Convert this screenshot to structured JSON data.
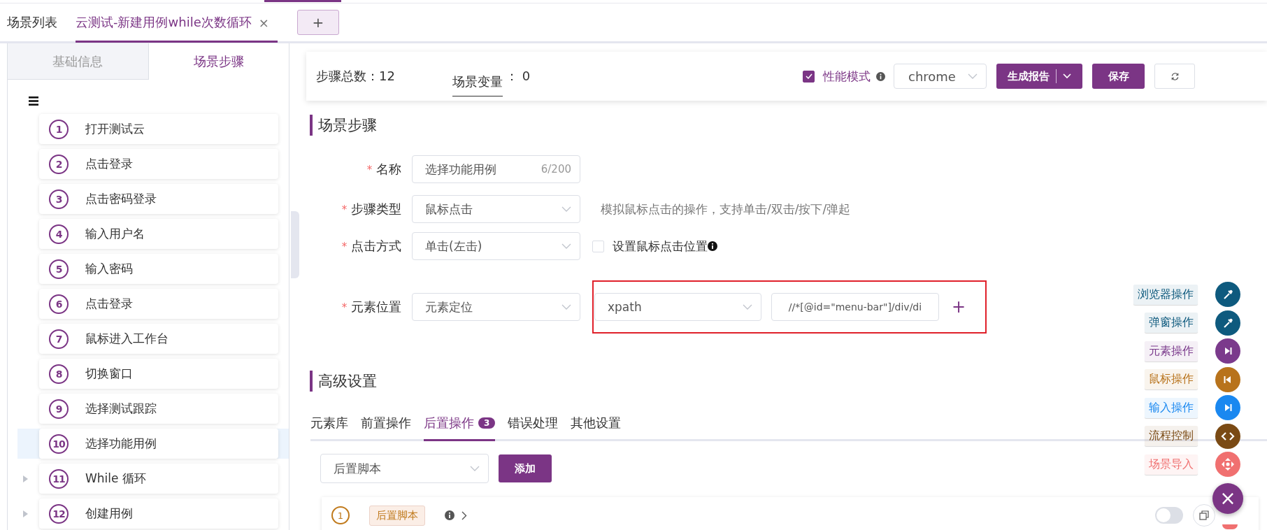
{
  "top_tabs": [
    {
      "label": "场景列表",
      "selected": false
    },
    {
      "label": "云测试-新建用例while次数循环",
      "selected": true,
      "close": "×"
    }
  ],
  "add_tab": "+",
  "side_tabs": [
    {
      "label": "基础信息",
      "selected": false
    },
    {
      "label": "场景步骤",
      "selected": true
    }
  ],
  "steps": [
    {
      "number": "1",
      "label": "打开测试云",
      "selected": false,
      "expandable": false
    },
    {
      "number": "2",
      "label": "点击登录",
      "selected": false,
      "expandable": false
    },
    {
      "number": "3",
      "label": "点击密码登录",
      "selected": false,
      "expandable": false
    },
    {
      "number": "4",
      "label": "输入用户名",
      "selected": false,
      "expandable": false
    },
    {
      "number": "5",
      "label": "输入密码",
      "selected": false,
      "expandable": false
    },
    {
      "number": "6",
      "label": "点击登录",
      "selected": false,
      "expandable": false
    },
    {
      "number": "7",
      "label": "鼠标进入工作台",
      "selected": false,
      "expandable": false
    },
    {
      "number": "8",
      "label": "切换窗口",
      "selected": false,
      "expandable": false
    },
    {
      "number": "9",
      "label": "选择测试跟踪",
      "selected": false,
      "expandable": false
    },
    {
      "number": "10",
      "label": "选择功能用例",
      "selected": true,
      "expandable": false
    },
    {
      "number": "11",
      "label": "While 循环",
      "selected": false,
      "expandable": true
    },
    {
      "number": "12",
      "label": "创建用例",
      "selected": false,
      "expandable": true
    }
  ],
  "header": {
    "total": "步骤总数：12",
    "variables_label": "场景变量",
    "variables_value": "： 0",
    "perf_mode": {
      "label": "性能模式",
      "checked": true
    },
    "browser": "chrome",
    "report_button": "生成报告",
    "save_button": "保存"
  },
  "section_title": "场景步骤",
  "form": [
    {
      "kind": "input",
      "required_mark": "*",
      "label": "名称",
      "value": "选择功能用例",
      "counter": "6/200"
    },
    {
      "kind": "select",
      "required_mark": "*",
      "label": "步骤类型",
      "value": "鼠标点击",
      "hint": "模拟鼠标点击的操作，支持单击/双击/按下/弹起"
    },
    {
      "kind": "select",
      "required_mark": "*",
      "label": "点击方式",
      "value": "单击(左击)",
      "checkbox": {
        "label": "设置鼠标点击位置",
        "checked": false
      }
    },
    {
      "kind": "locator",
      "required_mark": "*",
      "label": "元素位置",
      "value": "元素定位",
      "strategy": "xpath",
      "locator": "//*[@id=\"menu-bar\"]/div/di",
      "add": "+",
      "highlighted": true
    }
  ],
  "advanced": {
    "title": "高级设置",
    "tabs": [
      {
        "label": "元素库",
        "selected": false
      },
      {
        "label": "前置操作",
        "selected": false
      },
      {
        "label": "后置操作",
        "selected": true,
        "badge": "3"
      },
      {
        "label": "错误处理",
        "selected": false
      },
      {
        "label": "其他设置",
        "selected": false
      }
    ],
    "script_select": "后置脚本",
    "add_button": "添加",
    "scripts": [
      {
        "number": "1",
        "tag": "后置脚本",
        "enabled": false
      }
    ]
  },
  "fab_menu": [
    {
      "label": "浏览器操作",
      "kind": "pipette",
      "color": "#0e5a7e"
    },
    {
      "label": "弹窗操作",
      "kind": "pipette",
      "color": "#0e5a7e"
    },
    {
      "label": "元素操作",
      "kind": "next",
      "color": "#7b3a8c"
    },
    {
      "label": "鼠标操作",
      "kind": "prev",
      "color": "#b8731c"
    },
    {
      "label": "输入操作",
      "kind": "next",
      "color": "#1a88f0"
    },
    {
      "label": "流程控制",
      "kind": "code",
      "color": "#7a4a14"
    },
    {
      "label": "场景导入",
      "kind": "move",
      "color": "#f07070"
    }
  ],
  "fab_close": "×"
}
